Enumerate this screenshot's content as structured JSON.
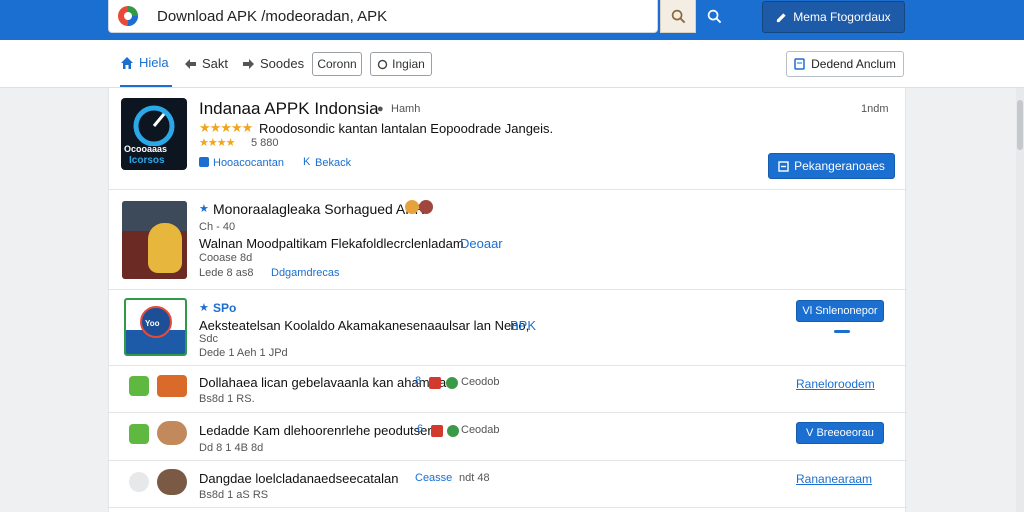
{
  "search": {
    "value": "Download APK /modeoradan, APK",
    "search_icon": "search-icon",
    "top_button_label": "Mema Ftogordaux"
  },
  "nav": {
    "tabs": [
      {
        "label": "Hiela",
        "icon": "home-icon"
      },
      {
        "label": "Sakt",
        "icon": "back-arrow-icon"
      },
      {
        "label": "Soodes",
        "icon": "forward-arrow-icon"
      }
    ],
    "box1": "Coronn",
    "box2": "Ingian",
    "right_button": "Dedend Anclum"
  },
  "apps": [
    {
      "title": "Indanaa APPK Indonsia",
      "title_tag": "Hamh",
      "time": "1ndm",
      "desc": "Roodosondic kantan lantalan Eopoodrade Jangeis.",
      "rating": "5 880",
      "link1": "Hooacocantan",
      "link2": "Bekack",
      "button": "Pekangeranoaes",
      "icon_text": [
        "Ocooaaas",
        "Icorsos"
      ]
    },
    {
      "title": "Monoraalagleaka Sorhagued APR",
      "meta1": "Ch - 40",
      "desc": "Walnan Moodpaltikam Flekafoldlecrclenladam",
      "desc_link": "Deoaar",
      "meta2": "Cooase 8d",
      "meta3": "Lede 8 as8",
      "meta3_link": "Ddgamdrecas"
    },
    {
      "title": "SPo",
      "desc": "Aeksteatelsan Koolaldo Akamakanesenaaulsar lan Neno,",
      "desc_link": "BPK",
      "meta1": "Sdc",
      "meta2": "Dede 1 Aeh 1 JPd",
      "button": "Vl Snlenonepor",
      "icon_text": "Yoo"
    },
    {
      "title": "Dollahaea lican gebelavaanla kan ahamkia:",
      "extra": "Ceodob",
      "badge_num": "8",
      "meta": "Bs8d 1 RS.",
      "action": "Raneloroodem"
    },
    {
      "title": "Ledadde Kam dlehoorenrlehe peodutser",
      "extra": "Ceodab",
      "badge_num": "6",
      "meta": "Dd 8 1 4B 8d",
      "action": "V Breeoeorau"
    },
    {
      "title": "Dangdae loelcladanaedseecatalan",
      "extra_link": "Ceasse",
      "extra": "ndt 48",
      "meta": "Bs8d 1 aS RS",
      "action": "Rananearaam"
    }
  ],
  "colors": {
    "brand": "#1a6fd0",
    "star": "#f2a51a"
  }
}
